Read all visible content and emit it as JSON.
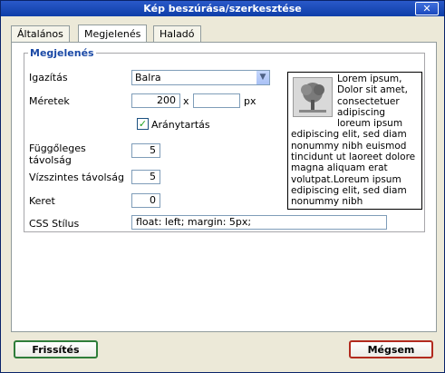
{
  "window": {
    "title": "Kép beszúrása/szerkesztése",
    "close_glyph": "✕"
  },
  "tabs": [
    {
      "label": "Általános",
      "active": false
    },
    {
      "label": "Megjelenés",
      "active": true
    },
    {
      "label": "Haladó",
      "active": false
    }
  ],
  "appearance": {
    "legend": "Megjelenés",
    "align_label": "Igazítás",
    "align_value": "Balra",
    "dimensions_label": "Méretek",
    "width_value": "200",
    "times_glyph": "x",
    "height_value": "",
    "unit": "px",
    "constrain_label": "Aránytartás",
    "constrain_checked": true,
    "vspace_label": "Függőleges távolság",
    "vspace_value": "5",
    "hspace_label": "Vízszintes távolság",
    "hspace_value": "5",
    "border_label": "Keret",
    "border_value": "0",
    "style_label": "CSS Stílus",
    "style_value": "float: left; margin: 5px;",
    "preview_text": "Lorem ipsum, Dolor sit amet, consectetuer adipiscing loreum ipsum edipiscing elit, sed diam nonummy nibh euismod tincidunt ut laoreet dolore magna aliquam erat volutpat.Loreum ipsum edipiscing elit, sed diam nonummy nibh"
  },
  "footer": {
    "update_label": "Frissítés",
    "cancel_label": "Mégsem"
  },
  "colors": {
    "titlebar": "#1a48bf",
    "legend": "#1c4aa6",
    "update_border": "#2f7d3a",
    "cancel_border": "#b22a1e"
  }
}
